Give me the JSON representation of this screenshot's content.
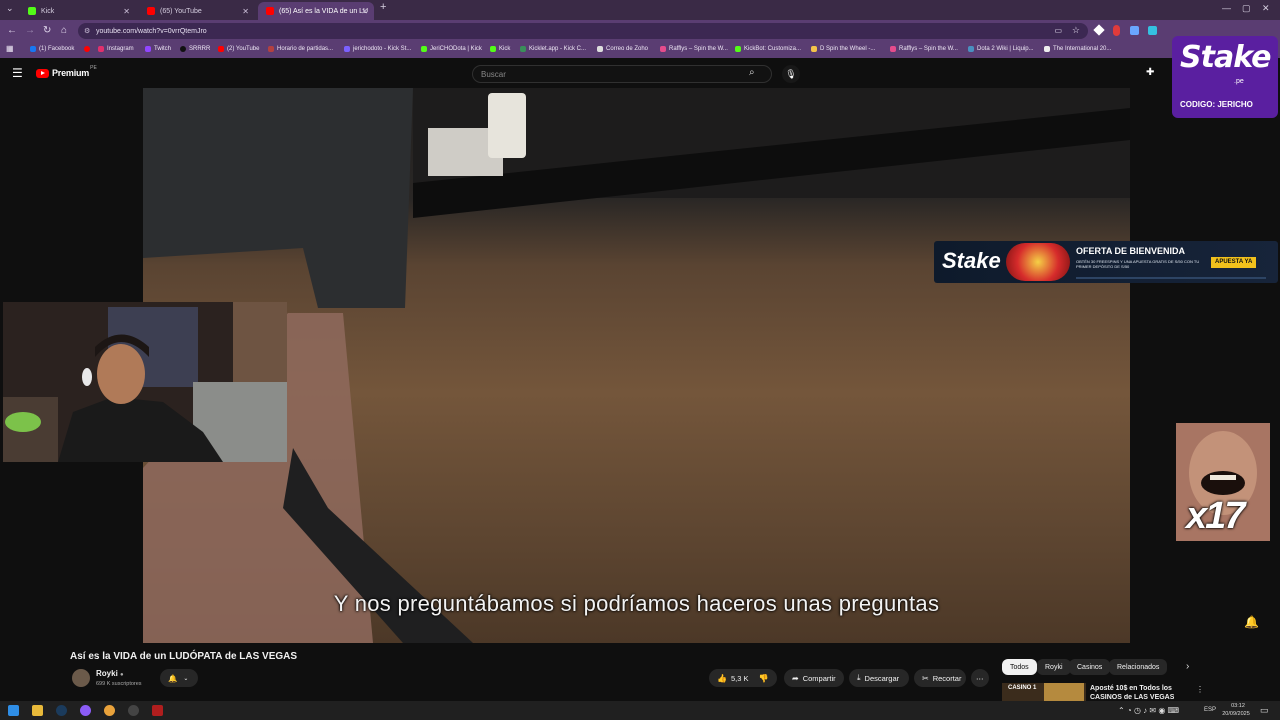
{
  "browser": {
    "tabs": [
      {
        "label": "Kick",
        "fav_color": "#53fc18"
      },
      {
        "label": "(65) YouTube",
        "fav_color": "#ff0000"
      },
      {
        "label": "(65) Así es la VIDA de un LU",
        "fav_color": "#ff0000"
      }
    ],
    "url": "youtube.com/watch?v=0vrrQtemJro",
    "bookmarks": [
      "(1) Facebook",
      "Instagram",
      "Twitch",
      "SRRRR",
      "(2) YouTube",
      "Horario de partidas...",
      "jerichodoto - Kick St...",
      "JeriCHODota | Kick",
      "Kick",
      "Kicklet.app - Kick C...",
      "Correo de Zoho",
      "Rafflys – Spin the W...",
      "KickBot: Customiza...",
      "D Spin the Wheel -...",
      "Rafflys – Spin the W...",
      "Dota 2 Wiki | Liquip...",
      "The International 20..."
    ]
  },
  "youtube": {
    "logo_text": "Premium",
    "logo_region": "PE",
    "search_placeholder": "Buscar",
    "subtitle": "Y nos preguntábamos si podríamos haceros unas preguntas",
    "video_title": "Así es la VIDA de un LUDÓPATA de LAS VEGAS",
    "channel_name": "Royki",
    "subscribers": "699 K suscriptores",
    "likes": "5,3 K",
    "share_label": "Compartir",
    "download_label": "Descargar",
    "clip_label": "Recortar",
    "chips": [
      "Todos",
      "Royki",
      "Casinos",
      "Relacionados"
    ],
    "related_title": "Aposté 10$ en Todos los",
    "related_title2": "CASINOS de LAS VEGAS",
    "related_thumb_label": "CASINO 1"
  },
  "overlays": {
    "stake_logo": "Stake",
    "stake_domain": ".pe",
    "stake_code": "CODIGO: JERICHO",
    "banner_brand": "Stake",
    "banner_headline": "OFERTA DE BIENVENIDA",
    "banner_body": "OBTÉN 30 FREESPINS Y UNA APUESTA GRATIS DE S/50 CON TU PRIMER DEPÓSITO DE S/50",
    "banner_cta": "APUESTA YA",
    "meme_counter": "x17"
  },
  "taskbar": {
    "language": "ESP",
    "time": "03:12",
    "date": "20/09/2025"
  },
  "colors": {
    "browser_frame": "#5a3d72",
    "youtube_red": "#ff0000",
    "stake_purple": "#5a1fa0",
    "banner_cta_yellow": "#f2c11c"
  }
}
